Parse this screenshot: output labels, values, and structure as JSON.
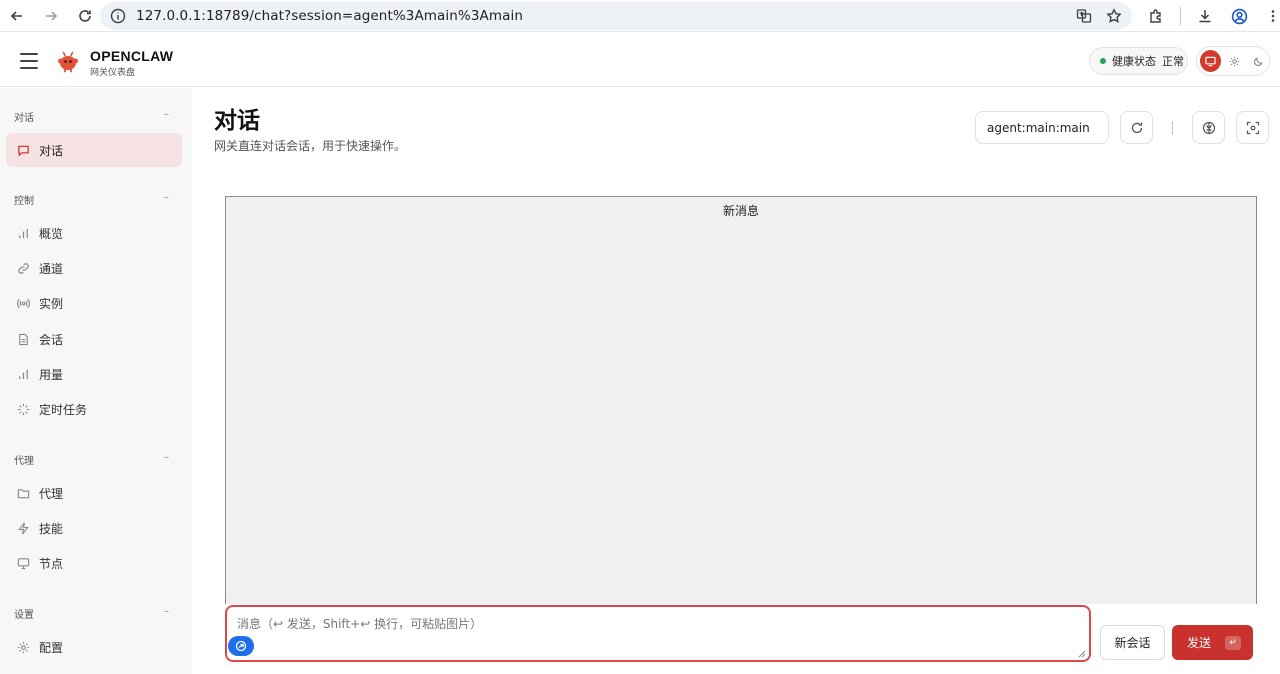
{
  "browser": {
    "url": "127.0.0.1:18789/chat?session=agent%3Amain%3Amain"
  },
  "header": {
    "brand_title": "OPENCLAW",
    "brand_subtitle": "网关仪表盘",
    "health_label": "健康状态",
    "health_value": "正常",
    "colors": {
      "accent": "#c8312c",
      "health_ok": "#22a356"
    }
  },
  "sidebar": {
    "groups": [
      {
        "label": "对话",
        "collapse": "–"
      },
      {
        "label": "控制",
        "collapse": "–"
      },
      {
        "label": "代理",
        "collapse": "–"
      },
      {
        "label": "设置",
        "collapse": "–"
      }
    ],
    "items": [
      {
        "label": "对话",
        "icon": "chat-bubble-icon",
        "active": true
      },
      {
        "label": "概览",
        "icon": "bar-chart-icon"
      },
      {
        "label": "通道",
        "icon": "link-icon"
      },
      {
        "label": "实例",
        "icon": "broadcast-icon"
      },
      {
        "label": "会话",
        "icon": "document-icon"
      },
      {
        "label": "用量",
        "icon": "bar-chart-icon"
      },
      {
        "label": "定时任务",
        "icon": "loader-icon"
      },
      {
        "label": "代理",
        "icon": "folder-icon"
      },
      {
        "label": "技能",
        "icon": "lightning-icon"
      },
      {
        "label": "节点",
        "icon": "monitor-icon"
      },
      {
        "label": "配置",
        "icon": "gear-icon"
      }
    ]
  },
  "main": {
    "title": "对话",
    "subtitle": "网关直连对话会话，用于快速操作。",
    "session_value": "agent:main:main",
    "new_messages_label": "新消息",
    "composer_placeholder": "消息（↩ 发送，Shift+↩ 换行，可粘贴图片）",
    "new_session_label": "新会话",
    "send_label": "发送",
    "send_kbd": "↵"
  }
}
